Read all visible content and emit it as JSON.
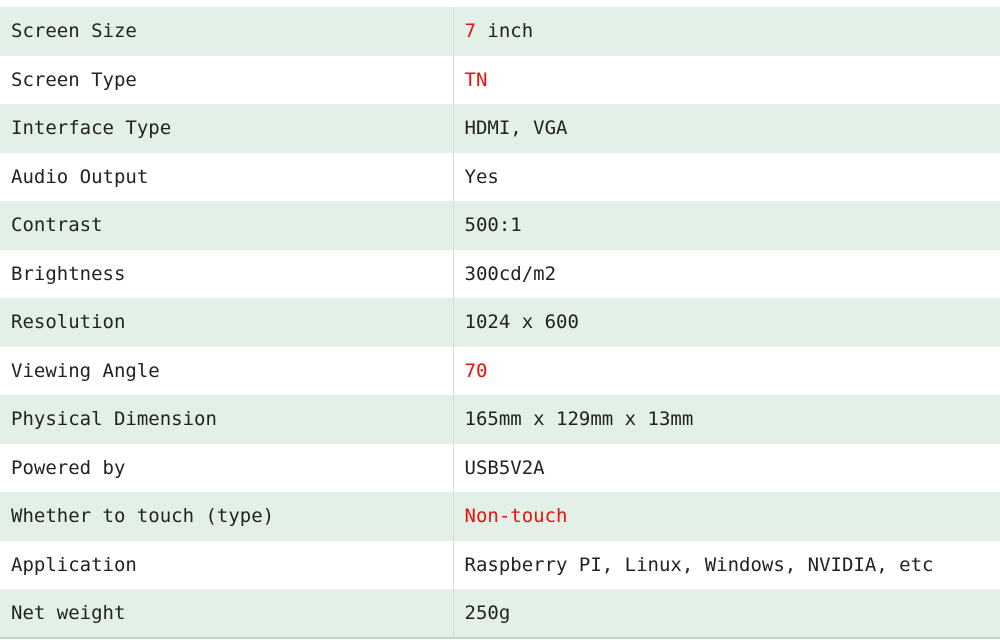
{
  "highlight_color": "#e8120c",
  "row_shade_color": "#e3f0e8",
  "specs": [
    {
      "label": "Screen Size",
      "value_highlight": "7",
      "value_rest": " inch"
    },
    {
      "label": "Screen Type",
      "value_highlight": "TN",
      "value_rest": ""
    },
    {
      "label": "Interface Type",
      "value_highlight": "",
      "value_rest": "HDMI, VGA"
    },
    {
      "label": "Audio Output",
      "value_highlight": "",
      "value_rest": "Yes"
    },
    {
      "label": "Contrast",
      "value_highlight": "",
      "value_rest": "500:1"
    },
    {
      "label": "Brightness",
      "value_highlight": "",
      "value_rest": "300cd/m2"
    },
    {
      "label": "Resolution",
      "value_highlight": "",
      "value_rest": "1024 x 600"
    },
    {
      "label": "Viewing Angle",
      "value_highlight": "70",
      "value_rest": ""
    },
    {
      "label": "Physical Dimension",
      "value_highlight": "",
      "value_rest": "165mm x 129mm x 13mm"
    },
    {
      "label": "Powered by",
      "value_highlight": "",
      "value_rest": "USB5V2A"
    },
    {
      "label": "Whether to touch (type)",
      "value_highlight": "Non-touch",
      "value_rest": ""
    },
    {
      "label": "Application",
      "value_highlight": "",
      "value_rest": "Raspberry PI, Linux, Windows, NVIDIA, etc"
    },
    {
      "label": "Net weight",
      "value_highlight": "",
      "value_rest": "250g"
    }
  ]
}
